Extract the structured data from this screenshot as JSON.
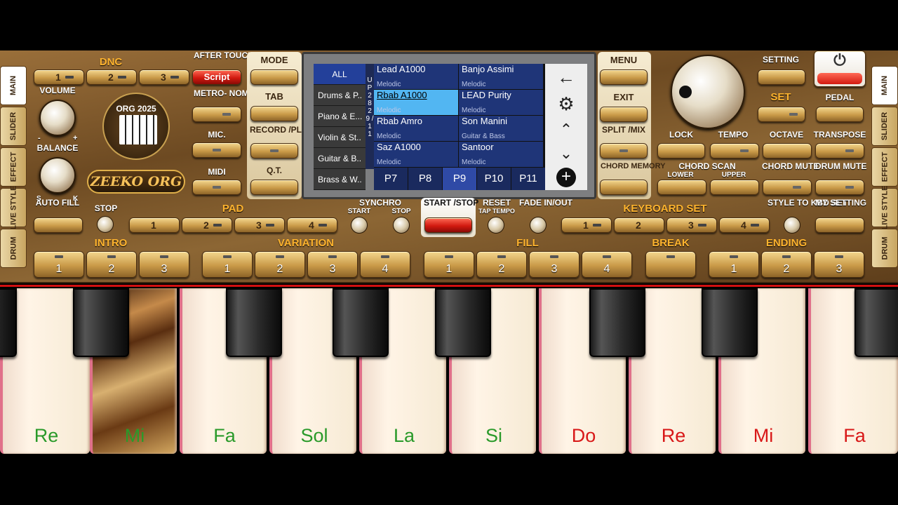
{
  "side_tabs": [
    "MAIN",
    "SLIDER",
    "EFFECT",
    "LIVE STYLE",
    "DRUM"
  ],
  "dnc": {
    "label": "DNC",
    "buttons": [
      "1",
      "2",
      "3"
    ]
  },
  "after_touch": {
    "label": "AFTER TOUCH",
    "value": "Script"
  },
  "volume_label": "VOLUME",
  "balance_label": "BALANCE",
  "balance_marks": {
    "minus": "-",
    "plus": "+",
    "s": "S",
    "k": "K"
  },
  "logo_badge": "ORG 2025",
  "logo_text": "ZEEKO ORG",
  "metronome_label": "METRO- NOME",
  "mic_label": "MIC.",
  "midi_label": "MIDI",
  "mode_label": "MODE",
  "tab_label": "TAB",
  "record_label": "RECORD /PLAY",
  "qt_label": "Q.T.",
  "menu_label": "MENU",
  "exit_label": "EXIT",
  "split_label": "SPLIT /MIX",
  "chord_memory_label": "CHORD MEMORY",
  "setting_label": "SETTING",
  "set_label": "SET",
  "pedal_label": "PEDAL",
  "lock_label": "LOCK",
  "tempo_label": "TEMPO",
  "octave_label": "OCTAVE",
  "transpose_label": "TRANSPOSE",
  "chord_scan": {
    "label": "CHORD SCAN",
    "lower": "LOWER",
    "upper": "UPPER"
  },
  "chord_mute_label": "CHORD MUTE",
  "drum_mute_label": "DRUM MUTE",
  "auto_fill_label": "AUTO FILL",
  "stop_label": "STOP",
  "pad": {
    "label": "PAD",
    "buttons": [
      "1",
      "2",
      "3",
      "4"
    ]
  },
  "synchro": {
    "label": "SYNCHRO",
    "start": "START",
    "stop": "STOP"
  },
  "start_stop_label": "START /STOP",
  "reset_label": "RESET",
  "reset_sub": "TAP TEMPO",
  "fade_label": "FADE IN/OUT",
  "keyboard_set": {
    "label": "KEYBOARD SET",
    "buttons": [
      "1",
      "2",
      "3",
      "4"
    ]
  },
  "style_to_kbd_label": "STYLE TO KBD SET",
  "my_setting_label": "MY SETTING",
  "intro": {
    "label": "INTRO",
    "buttons": [
      "1",
      "2",
      "3"
    ]
  },
  "variation": {
    "label": "VARIATION",
    "buttons": [
      "1",
      "2",
      "3",
      "4"
    ]
  },
  "fill": {
    "label": "FILL",
    "buttons": [
      "1",
      "2",
      "3",
      "4"
    ]
  },
  "break_label": "BREAK",
  "ending": {
    "label": "ENDING",
    "buttons": [
      "1",
      "2",
      "3"
    ]
  },
  "screen": {
    "categories": [
      "ALL",
      "Drums & P..",
      "Piano & E...",
      "Violin & St..",
      "Guitar & B..",
      "Brass & W.."
    ],
    "up_bar": "U P 2 8 2 9 / 1 1",
    "voices": [
      {
        "name": "Lead A1000",
        "cat": "Melodic"
      },
      {
        "name": "Banjo Assimi",
        "cat": "Melodic"
      },
      {
        "name": "Rbab A1000",
        "cat": "Melodic"
      },
      {
        "name": "LEAD Purity",
        "cat": "Melodic"
      },
      {
        "name": "Rbab Amro",
        "cat": "Melodic"
      },
      {
        "name": "Son Manini",
        "cat": "Guitar & Bass"
      },
      {
        "name": "Saz A1000",
        "cat": "Melodic"
      },
      {
        "name": "Santoor",
        "cat": "Melodic"
      }
    ],
    "selected_voice": 2,
    "pages": [
      "P7",
      "P8",
      "P9",
      "P10",
      "P11"
    ],
    "selected_page": 2,
    "nav_icons": [
      "back-arrow-icon",
      "gear-icon",
      "chevron-up-icon",
      "chevron-down-icon",
      "add-circle-icon"
    ]
  },
  "keys": {
    "notes": [
      "Re",
      "Mi",
      "Fa",
      "Sol",
      "La",
      "Si",
      "Do",
      "Re",
      "Mi",
      "Fa"
    ],
    "note_colors": [
      "#2a9a2a",
      "#2a9a2a",
      "#2a9a2a",
      "#2a9a2a",
      "#2a9a2a",
      "#2a9a2a",
      "#d81818",
      "#d81818",
      "#d81818",
      "#d81818"
    ],
    "pressed_index": 1
  },
  "colors": {
    "accent_orange": "#ffb42e",
    "selected_blue": "#52b6f2",
    "record_red": "#d21a10"
  }
}
